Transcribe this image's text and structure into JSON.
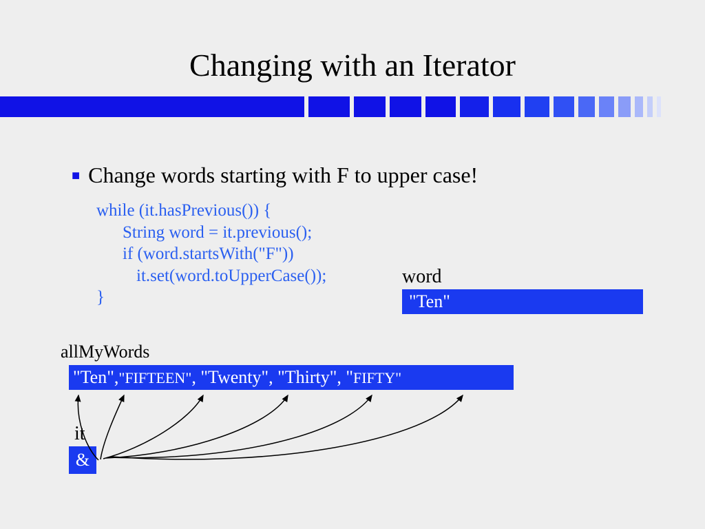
{
  "title": "Changing with an Iterator",
  "bullet": "Change words starting with F to upper case!",
  "code": {
    "l1": "while (it.hasPrevious()) {",
    "l2": "String word = it.previous();",
    "l3": "if (word.startsWith(\"F\"))",
    "l4": "it.set(word.toUpperCase());",
    "l5": "}"
  },
  "word": {
    "label": "word",
    "value": "\"Ten\""
  },
  "list": {
    "label": "allMyWords",
    "items": [
      {
        "text": "\"Ten\"",
        "small": false
      },
      {
        "text": ",",
        "small": false
      },
      {
        "text": "\"FIFTEEN\"",
        "small": true
      },
      {
        "text": ", \"Twenty\", \"Thirty\", ",
        "small": false
      },
      {
        "text": "\"",
        "small": false
      },
      {
        "text": "FIFTY\"",
        "small": true
      }
    ]
  },
  "it": {
    "label": "it",
    "value": "&"
  }
}
